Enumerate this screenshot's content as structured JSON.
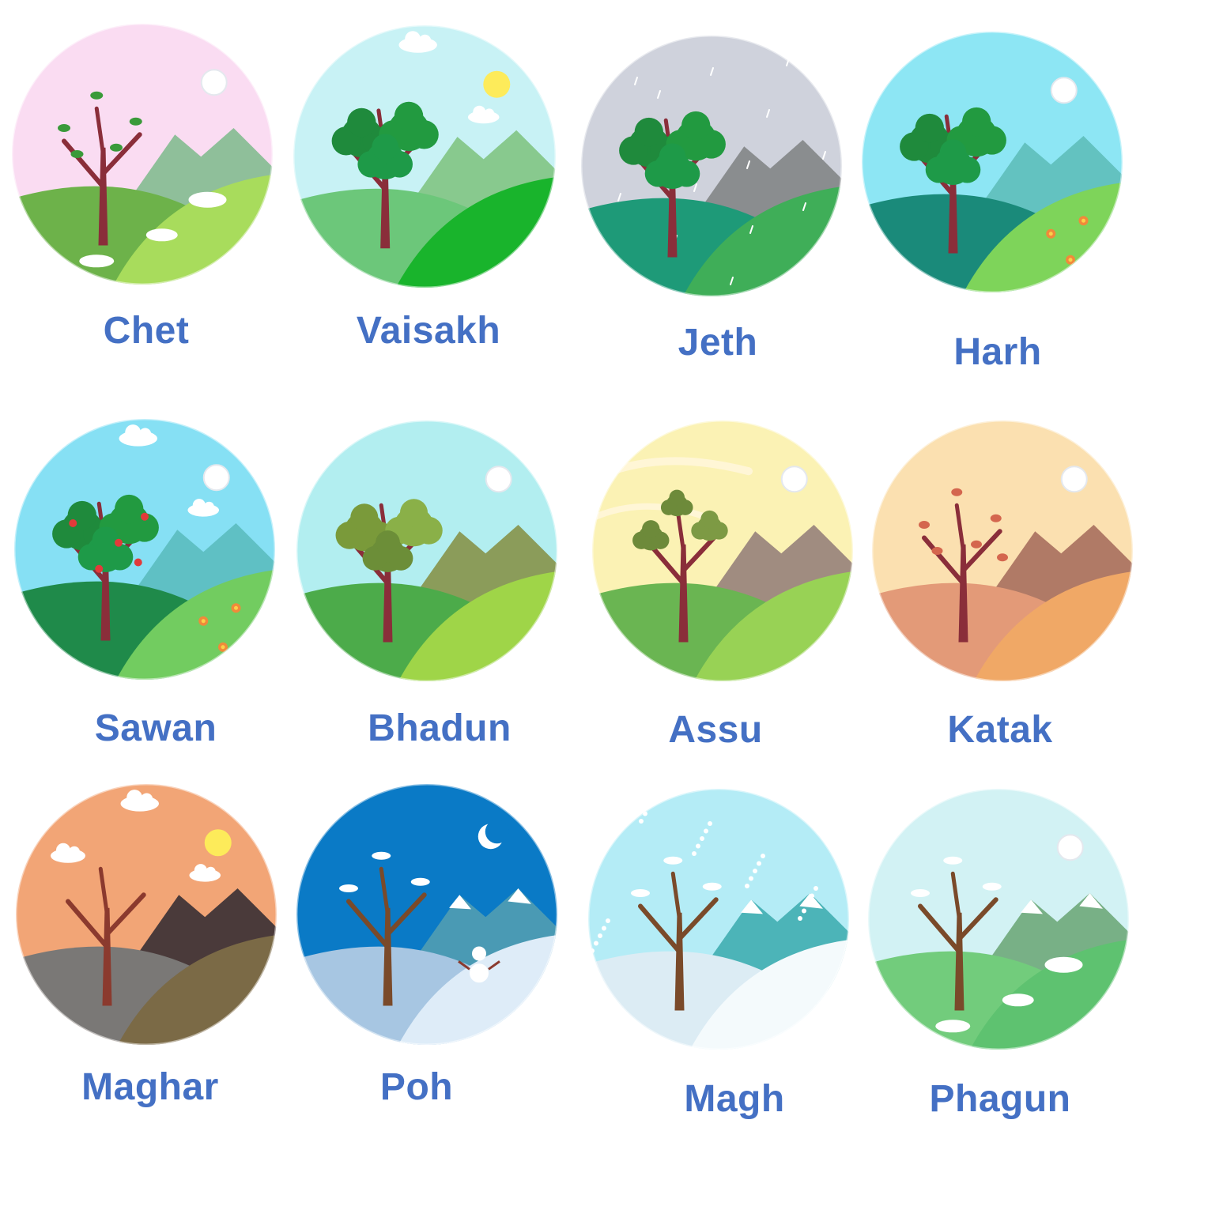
{
  "palette": {
    "label_color": "#4470c4",
    "ring": "#c9ccd2"
  },
  "months": [
    {
      "id": "chet",
      "name": "Chet",
      "scene": "spring-blossom",
      "sky": "#fadcf2",
      "tree": "sparse-leaves",
      "hill_far": "#8fbf9a",
      "hill_left": "#6db24a",
      "hill_right": "#a8dc5c",
      "sun": "white"
    },
    {
      "id": "vaisakh",
      "name": "Vaisakh",
      "scene": "full-green",
      "sky": "#c8f2f5",
      "tree": "full-green",
      "hill_far": "#88c98e",
      "hill_left": "#6cc77a",
      "hill_right": "#19b42c",
      "sun": "yellow"
    },
    {
      "id": "jeth",
      "name": "Jeth",
      "scene": "rain",
      "sky": "#cfd2dc",
      "tree": "full-green",
      "hill_far": "#8a8d8f",
      "hill_left": "#1e9a78",
      "hill_right": "#3fae58",
      "sun": "none"
    },
    {
      "id": "harh",
      "name": "Harh",
      "scene": "summer-flowers",
      "sky": "#8de6f4",
      "tree": "full-green",
      "hill_far": "#63c2c0",
      "hill_left": "#1a8a7a",
      "hill_right": "#7ed45a",
      "sun": "white"
    },
    {
      "id": "sawan",
      "name": "Sawan",
      "scene": "fruit-tree",
      "sky": "#86e0f4",
      "tree": "fruit",
      "hill_far": "#5fc0c4",
      "hill_left": "#1f8a4a",
      "hill_right": "#72cc60",
      "sun": "white"
    },
    {
      "id": "bhadun",
      "name": "Bhadun",
      "scene": "late-summer",
      "sky": "#b2eef0",
      "tree": "olive",
      "hill_far": "#8b9c5a",
      "hill_left": "#4cab4a",
      "hill_right": "#9fd548",
      "sun": "white"
    },
    {
      "id": "assu",
      "name": "Assu",
      "scene": "windy-autumn",
      "sky": "#fbf2b4",
      "tree": "olive-sparse",
      "hill_far": "#a08c80",
      "hill_left": "#6ab552",
      "hill_right": "#98d255",
      "sun": "white"
    },
    {
      "id": "katak",
      "name": "Katak",
      "scene": "autumn-bare",
      "sky": "#fbe0b0",
      "tree": "red-sparse",
      "hill_far": "#b07a66",
      "hill_left": "#e39a78",
      "hill_right": "#f0a866",
      "sun": "white"
    },
    {
      "id": "maghar",
      "name": "Maghar",
      "scene": "bare-dusk",
      "sky": "#f2a576",
      "tree": "bare",
      "hill_far": "#4a3a3a",
      "hill_left": "#7a7876",
      "hill_right": "#7b6a46",
      "sun": "yellow"
    },
    {
      "id": "poh",
      "name": "Poh",
      "scene": "winter-night",
      "sky": "#0a7ac6",
      "tree": "snow-bare",
      "hill_far": "#4a9ab4",
      "hill_left": "#a7c6e2",
      "hill_right": "#deecf8",
      "sun": "moon"
    },
    {
      "id": "magh",
      "name": "Magh",
      "scene": "snowfall",
      "sky": "#b4ecf6",
      "tree": "snow-bare",
      "hill_far": "#4cb4b8",
      "hill_left": "#dcecf4",
      "hill_right": "#f4fafc",
      "sun": "none"
    },
    {
      "id": "phagun",
      "name": "Phagun",
      "scene": "thaw",
      "sky": "#d2f2f4",
      "tree": "snow-bare",
      "hill_far": "#78b086",
      "hill_left": "#72cc7c",
      "hill_right": "#5ec270",
      "sun": "white"
    }
  ]
}
